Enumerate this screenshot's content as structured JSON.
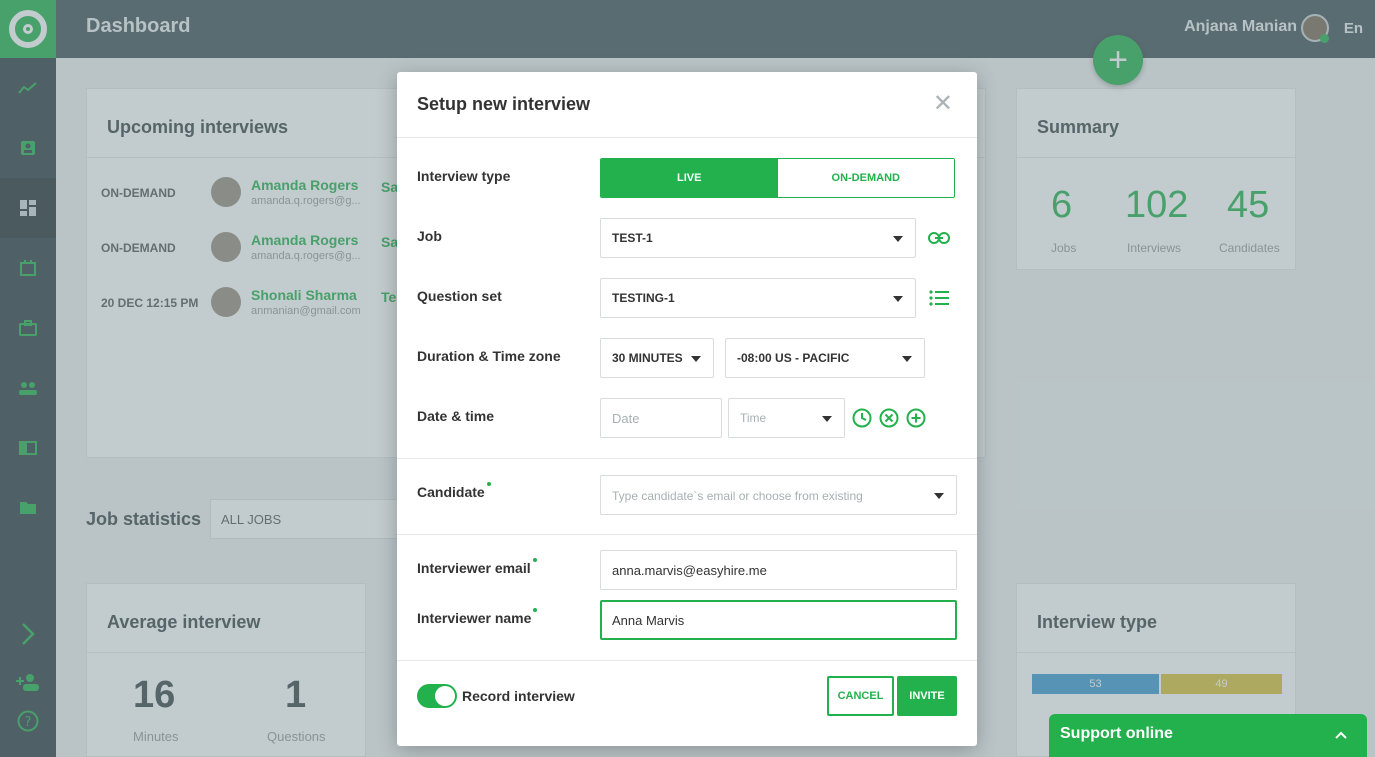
{
  "app": {
    "page_title": "Dashboard",
    "user_name": "Anjana Manian",
    "language": "En",
    "fab_label": "+"
  },
  "upcoming": {
    "title": "Upcoming interviews",
    "rows": [
      {
        "when": "ON-DEMAND",
        "name": "Amanda Rogers",
        "email": "amanda.q.rogers@g...",
        "job": "Sa"
      },
      {
        "when": "ON-DEMAND",
        "name": "Amanda Rogers",
        "email": "amanda.q.rogers@g...",
        "job": "Sa"
      },
      {
        "when": "20 DEC 12:15 PM",
        "name": "Shonali Sharma",
        "email": "anmanian@gmail.com",
        "job": "Te"
      }
    ]
  },
  "summary": {
    "title": "Summary",
    "stats": [
      {
        "value": "6",
        "label": "Jobs"
      },
      {
        "value": "102",
        "label": "Interviews"
      },
      {
        "value": "45",
        "label": "Candidates"
      }
    ]
  },
  "job_statistics": {
    "title": "Job statistics",
    "filter_value": "ALL JOBS"
  },
  "average_interview": {
    "title": "Average interview",
    "stats": [
      {
        "value": "16",
        "label": "Minutes"
      },
      {
        "value": "1",
        "label": "Questions"
      }
    ]
  },
  "interview_type_card": {
    "title": "Interview type",
    "bar_live": "53",
    "bar_ondemand": "49"
  },
  "modal": {
    "title": "Setup new interview",
    "close_glyph": "✕",
    "interview_type": {
      "label": "Interview type",
      "options": [
        "LIVE",
        "ON-DEMAND"
      ],
      "selected": "LIVE"
    },
    "job": {
      "label": "Job",
      "value": "TEST-1"
    },
    "question_set": {
      "label": "Question set",
      "value": "TESTING-1"
    },
    "duration_tz": {
      "label": "Duration & Time zone",
      "duration": "30 MINUTES",
      "timezone": "-08:00 US - PACIFIC"
    },
    "date_time": {
      "label": "Date & time",
      "date_placeholder": "Date",
      "time_placeholder": "Time"
    },
    "candidate": {
      "label": "Candidate",
      "placeholder": "Type candidate`s email or choose from existing"
    },
    "interviewer_email": {
      "label": "Interviewer email",
      "value": "anna.marvis@easyhire.me"
    },
    "interviewer_name": {
      "label": "Interviewer name",
      "value": "Anna Marvis"
    },
    "record": {
      "label": "Record interview",
      "enabled": true
    },
    "cancel_label": "CANCEL",
    "invite_label": "INVITE"
  },
  "support": {
    "label": "Support online",
    "chevron": "︿"
  },
  "colors": {
    "accent": "#22b14c",
    "sidebar": "#2f3f46",
    "topbar": "#415258"
  }
}
